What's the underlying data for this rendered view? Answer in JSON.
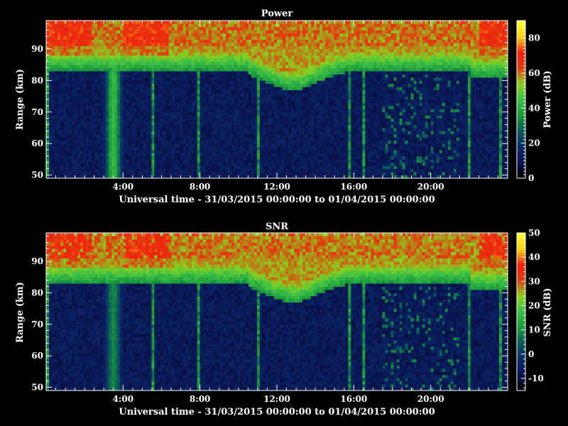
{
  "chart_data": [
    {
      "type": "heatmap",
      "title": "Power",
      "xlabel": "Universal time - 31/03/2015 00:00:00 to 01/04/2015 00:00:00",
      "ylabel": "Range (km)",
      "x_ticks": [
        "4:00",
        "8:00",
        "12:00",
        "16:00",
        "20:00"
      ],
      "x_tick_hours": [
        4,
        8,
        12,
        16,
        20
      ],
      "xlim_hours": [
        0,
        24
      ],
      "y_ticks": [
        50,
        60,
        70,
        80,
        90
      ],
      "ylim": [
        49,
        99
      ],
      "colorbar": {
        "label": "Power (dB)",
        "ticks": [
          0,
          20,
          40,
          60,
          80
        ],
        "range": [
          0,
          90
        ]
      },
      "colormap": [
        "#000000",
        "#0a1450",
        "#0b2a6a",
        "#0a5a5a",
        "#1a9a3a",
        "#3cc048",
        "#8ad020",
        "#e04010",
        "#f02010",
        "#f8d010",
        "#ffff40"
      ],
      "features": {
        "cutoff_height_km": 83,
        "high_power_layer_km": [
          88,
          99
        ],
        "strong_column_hour": 3.5,
        "typical_background": 10,
        "typical_high": 60
      }
    },
    {
      "type": "heatmap",
      "title": "SNR",
      "xlabel": "Universal time - 31/03/2015 00:00:00 to 01/04/2015 00:00:00",
      "ylabel": "Range (km)",
      "x_ticks": [
        "4:00",
        "8:00",
        "12:00",
        "16:00",
        "20:00"
      ],
      "x_tick_hours": [
        4,
        8,
        12,
        16,
        20
      ],
      "xlim_hours": [
        0,
        24
      ],
      "y_ticks": [
        50,
        60,
        70,
        80,
        90
      ],
      "ylim": [
        49,
        99
      ],
      "colorbar": {
        "label": "SNR (dB)",
        "ticks": [
          -10,
          0,
          10,
          20,
          30,
          40,
          50
        ],
        "range": [
          -15,
          50
        ]
      },
      "colormap": [
        "#000000",
        "#0a1450",
        "#0b2a6a",
        "#0a5a5a",
        "#1a9a3a",
        "#3cc048",
        "#8ad020",
        "#e04010",
        "#f02010",
        "#f8d010",
        "#ffff40"
      ],
      "features": {
        "cutoff_height_km": 83,
        "high_snr_layer_km": [
          88,
          99
        ],
        "strong_column_hour": 3.5,
        "typical_background": -8,
        "typical_high": 25
      }
    }
  ]
}
